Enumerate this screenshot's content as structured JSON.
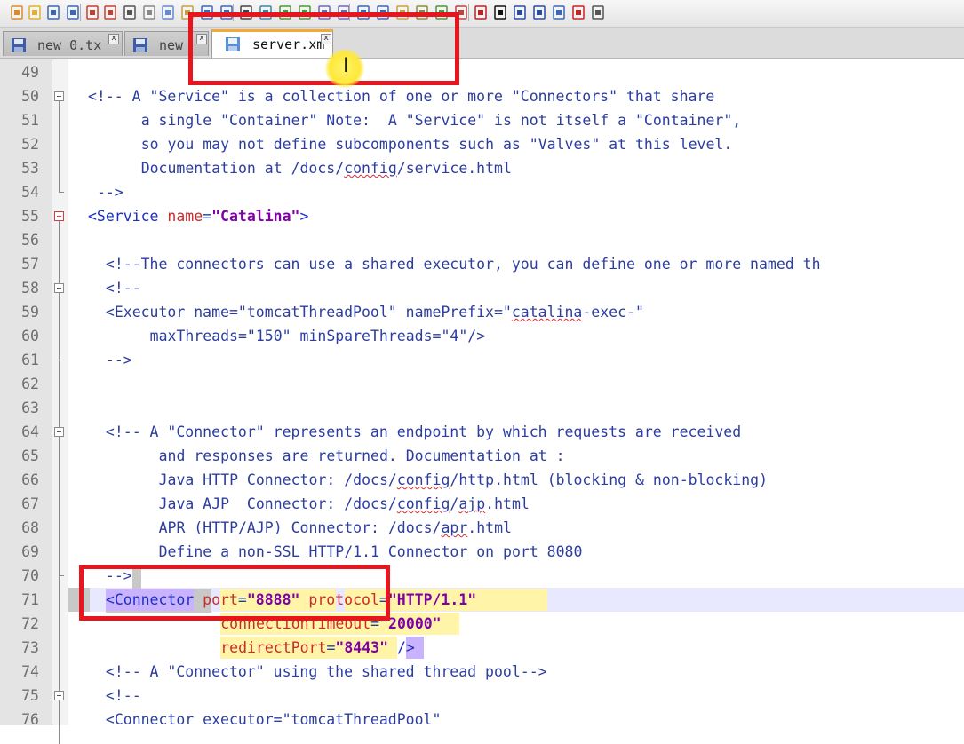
{
  "toolbar": {
    "icons": [
      "new-icon",
      "open-icon",
      "save-icon",
      "save-all-icon",
      "close-icon",
      "close-all-icon",
      "print-icon",
      "cut-icon",
      "copy-icon",
      "paste-icon",
      "undo-icon",
      "redo-icon",
      "find-icon",
      "replace-icon",
      "zoom-in-icon",
      "zoom-out-icon",
      "sync-v-icon",
      "sync-h-icon",
      "wrap-icon",
      "show-all-chars-icon",
      "indent-guide-icon",
      "udl-icon",
      "doc-map-icon",
      "function-list-icon",
      "record-macro-icon",
      "stop-record-icon",
      "play-macro-icon",
      "run-macro-multiple-icon",
      "save-macro-icon",
      "spell-check-icon",
      "extra-icon"
    ]
  },
  "tabs": [
    {
      "label": "new  0.tx",
      "close": "x"
    },
    {
      "label": "new ",
      "close": "x"
    },
    {
      "label": "server.xm",
      "close": "x"
    }
  ],
  "lines": [
    {
      "n": "49"
    },
    {
      "n": "50"
    },
    {
      "n": "51"
    },
    {
      "n": "52"
    },
    {
      "n": "53"
    },
    {
      "n": "54"
    },
    {
      "n": "55"
    },
    {
      "n": "56"
    },
    {
      "n": "57"
    },
    {
      "n": "58"
    },
    {
      "n": "59"
    },
    {
      "n": "60"
    },
    {
      "n": "61"
    },
    {
      "n": "62"
    },
    {
      "n": "63"
    },
    {
      "n": "64"
    },
    {
      "n": "65"
    },
    {
      "n": "66"
    },
    {
      "n": "67"
    },
    {
      "n": "68"
    },
    {
      "n": "69"
    },
    {
      "n": "70"
    },
    {
      "n": "71"
    },
    {
      "n": "72"
    },
    {
      "n": "73"
    },
    {
      "n": "74"
    },
    {
      "n": "75"
    },
    {
      "n": "76"
    }
  ],
  "code": {
    "l50": "<!-- A \"Service\" is a collection of one or more \"Connectors\" that share",
    "l51": "a single \"Container\" Note:  A \"Service\" is not itself a \"Container\",",
    "l52": "so you may not define subcomponents such as \"Valves\" at this level.",
    "l53a": "Documentation at /docs/",
    "l53b": "config",
    "l53c": "/service.html",
    "l54": "-->",
    "l55_open": "<Service ",
    "l55_attr": "name",
    "l55_eq": "=",
    "l55_val": "\"Catalina\"",
    "l55_close": ">",
    "l57": "<!--The connectors can use a shared executor, you can define one or more named th",
    "l58": "<!--",
    "l59a": "<Executor name=\"tomcatThreadPool\" namePrefix=\"",
    "l59b": "catalina",
    "l59c": "-exec-\"",
    "l60": "maxThreads=\"150\" minSpareThreads=\"4\"/>",
    "l61": "-->",
    "l64": "<!-- A \"Connector\" represents an endpoint by which requests are received",
    "l65": "and responses are returned. Documentation at :",
    "l66a": "Java HTTP Connector: /docs/",
    "l66b": "config",
    "l66c": "/http.html (blocking & non-blocking)",
    "l67a": "Java AJP  Connector: /docs/",
    "l67b": "config",
    "l67c": "/",
    "l67d": "ajp",
    "l67e": ".html",
    "l68a": "APR (HTTP/AJP) Connector: /docs/",
    "l68b": "apr",
    "l68c": ".html",
    "l69": "Define a non-SSL HTTP/1.1 Connector on port 8080",
    "l70": "-->",
    "l71_tag": "<Connector",
    "l71_a1": "port",
    "l71_v1": "\"8888\"",
    "l71_a2": "protocol",
    "l71_v2": "\"HTTP/1.1\"",
    "l72_a": "connectionTimeout",
    "l72_v": "\"20000\"",
    "l73_a": "redirectPort",
    "l73_v": "\"8443\"",
    "l73_close": "/>",
    "l74": "<!-- A \"Connector\" using the shared thread pool-->",
    "l75": "<!--",
    "l76a": "<Connector ",
    "l76b": "executor",
    "l76c": "=",
    "l76d": "\"tomcatThreadPool\"",
    "eq": "="
  },
  "colors": {
    "annotation": "#e8141e",
    "active_tab_accent": "#f2a93b",
    "comment": "#2c3da0",
    "attribute": "#cc2a2a",
    "string": "#8000a8"
  }
}
